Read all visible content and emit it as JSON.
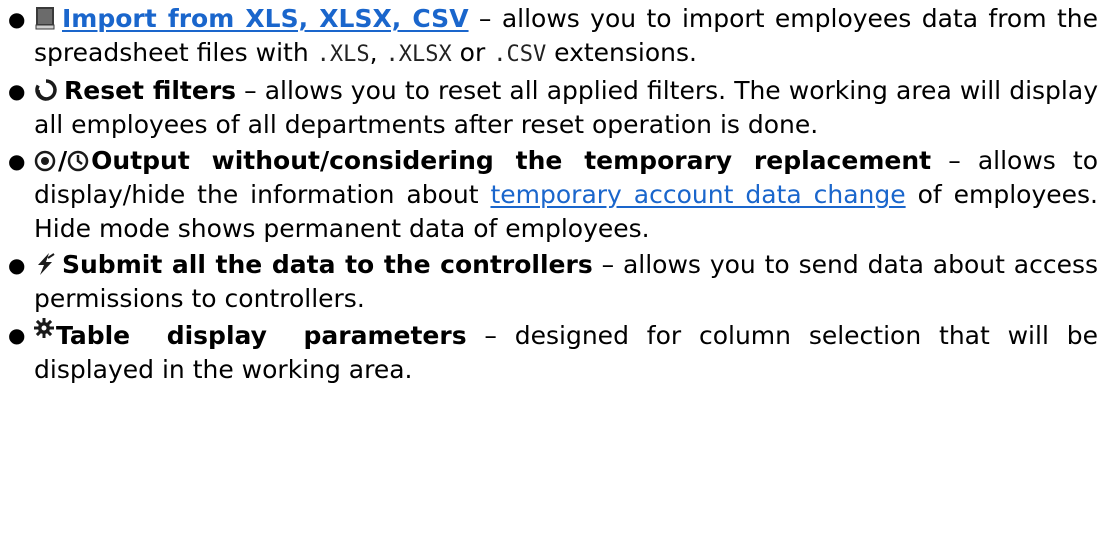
{
  "items": [
    {
      "icon": "book-icon",
      "title": "Import from XLS, XLSX, CSV",
      "dash": " – ",
      "desc_a": "allows you to import employees data from the spreadsheet files with ",
      "code1": ".XLS",
      "sep1": ", ",
      "code2": ".XLSX",
      "sep2": " or ",
      "code3": ".CSV",
      "desc_b": " extensions."
    },
    {
      "icon": "reset-icon",
      "title": "Reset filters",
      "dash": " – ",
      "desc": "allows you to reset all applied filters. The working area will display all employees of all departments after reset operation is done."
    },
    {
      "icon_a": "record-icon",
      "slash": "/",
      "icon_b": "clock-icon",
      "title": "Output without/considering the temporary replacement",
      "dash": "  – ",
      "desc_a": "allows to display/hide the information about ",
      "link": "temporary account data change",
      "desc_b": " of employees. Hide mode shows permanent data of employees."
    },
    {
      "icon": "lightning-icon",
      "title": "Submit all the data to the controllers",
      "dash": " – ",
      "desc": "allows you to send data about access permissions to controllers."
    },
    {
      "icon": "gear-icon",
      "title": "Table display parameters",
      "dash": " – ",
      "desc": "designed for column selection that will be displayed in the working area."
    }
  ],
  "colors": {
    "link": "#1a66cc",
    "text": "#000000"
  }
}
